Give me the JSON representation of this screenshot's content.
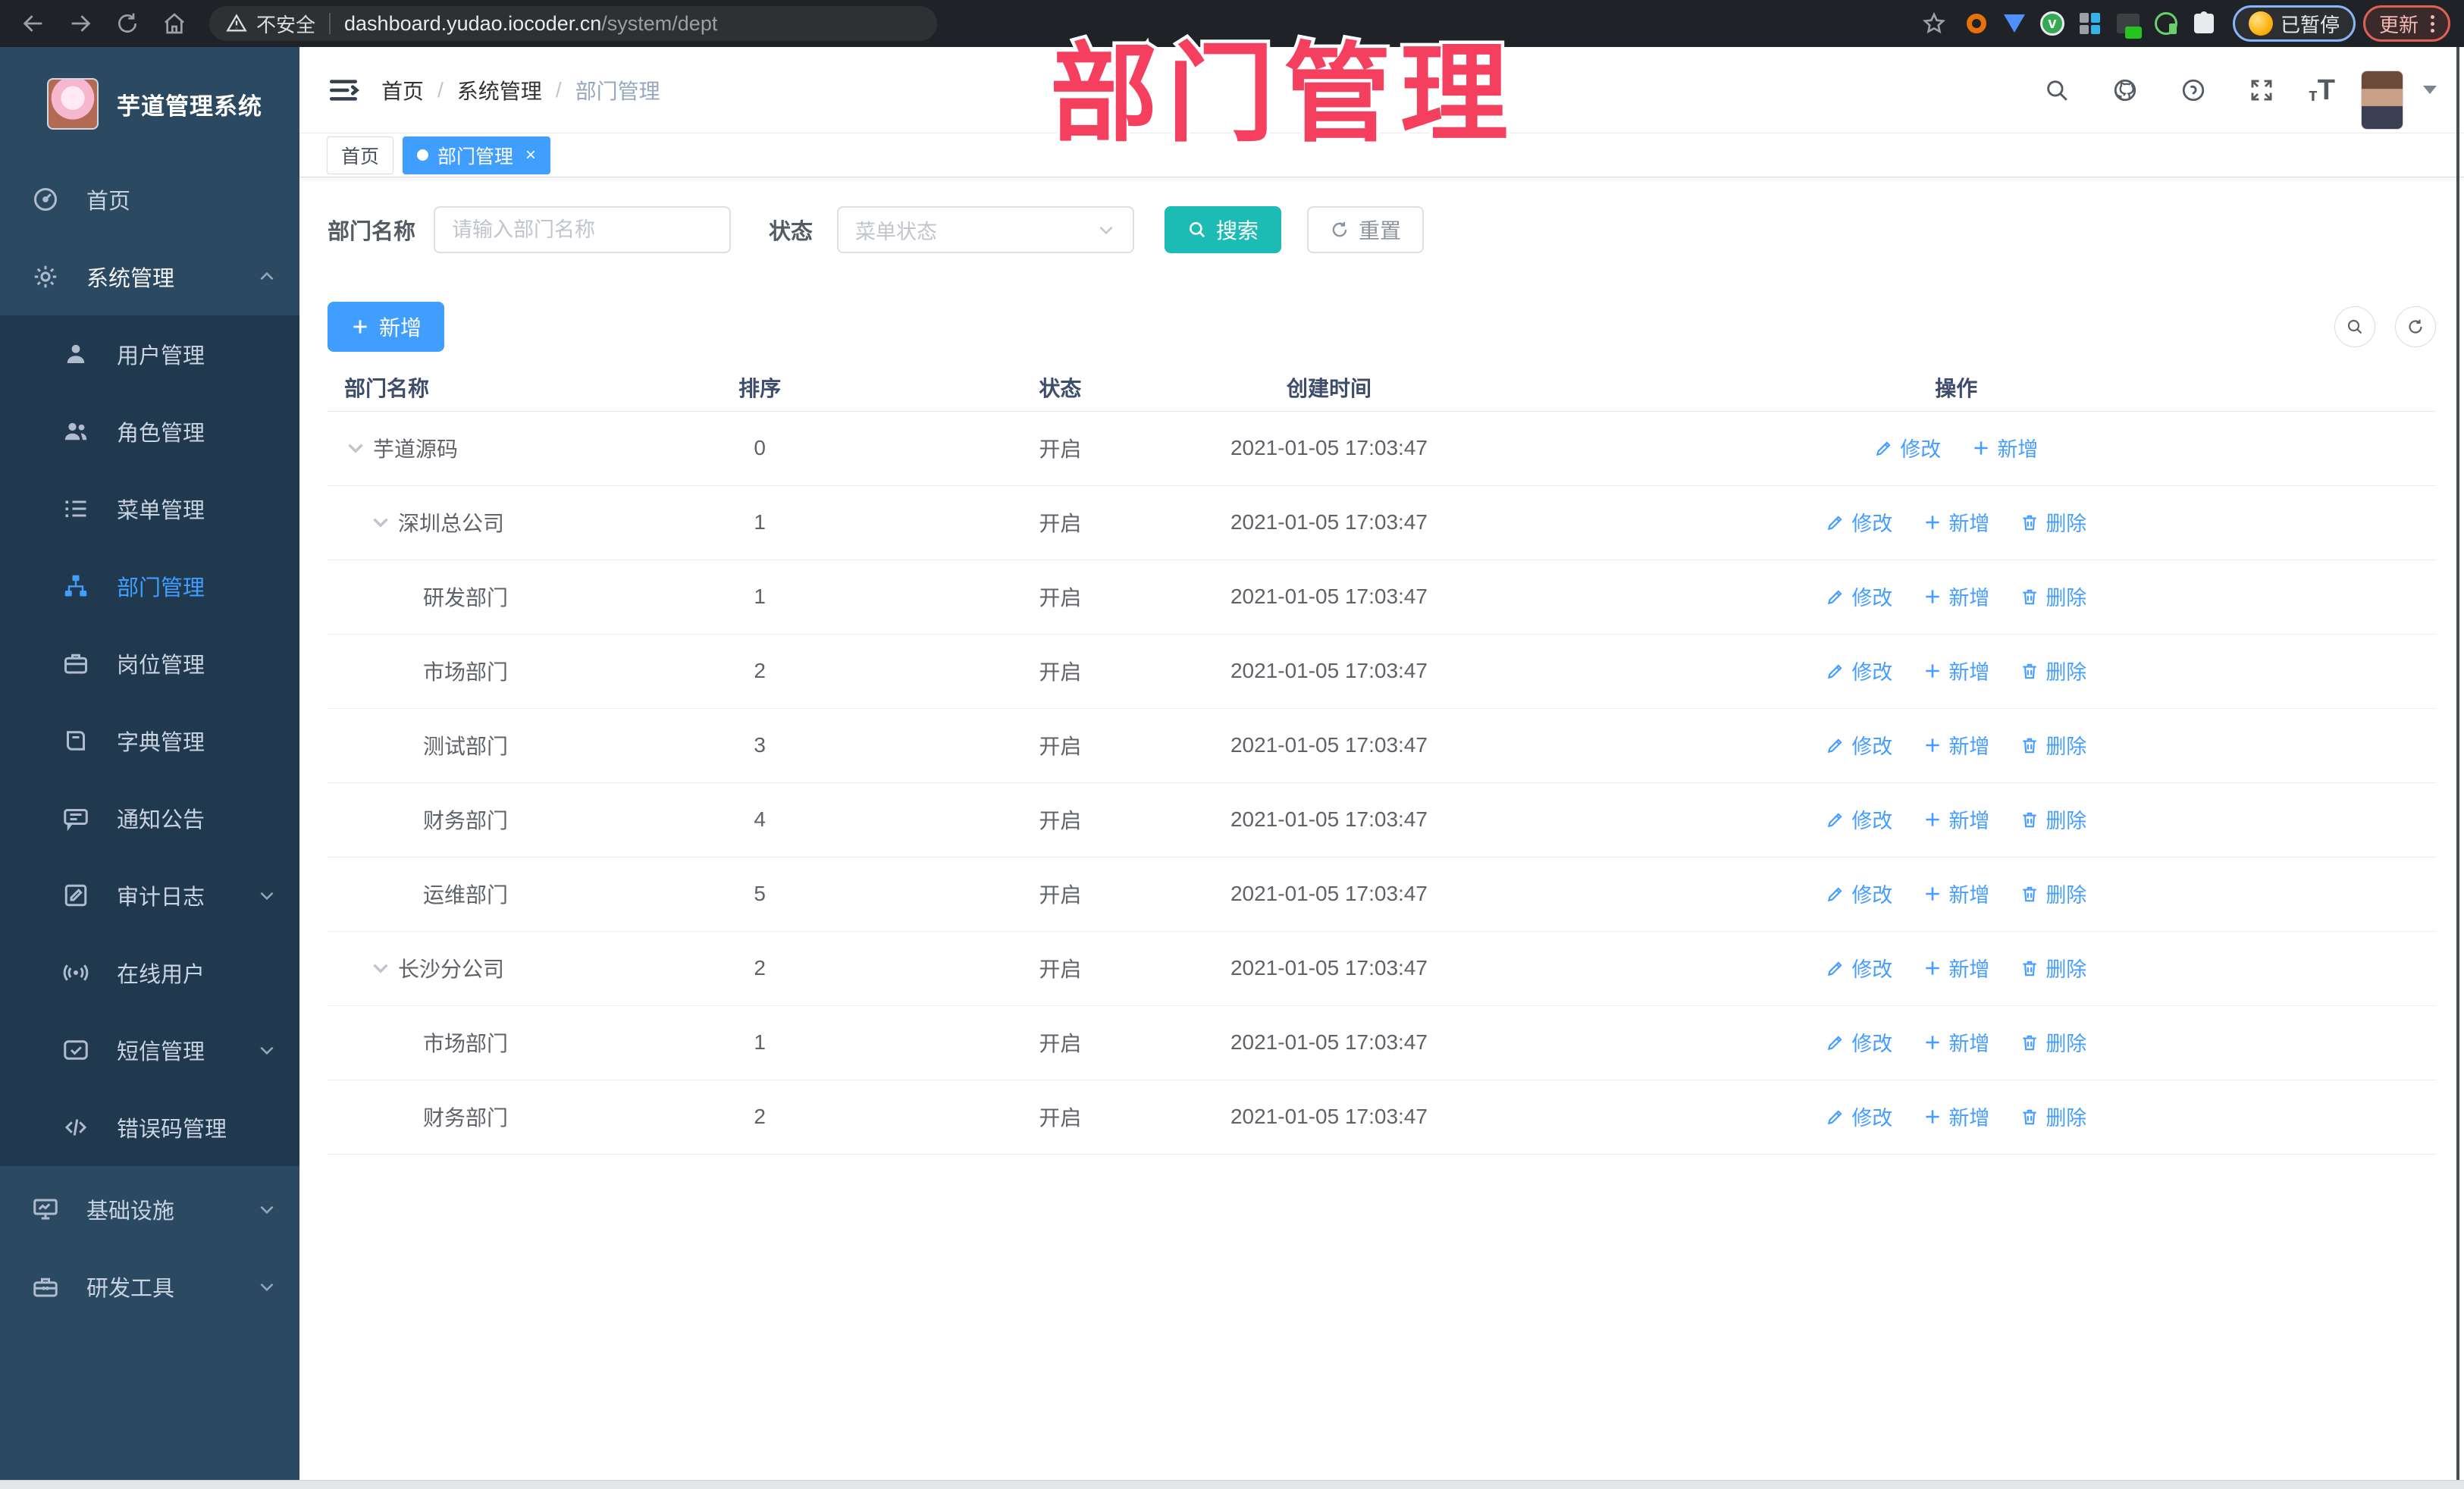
{
  "browser": {
    "security_text": "不安全",
    "url_host": "dashboard.yudao.iocoder.cn",
    "url_path": "/system/dept",
    "profile_status": "已暂停",
    "update_label": "更新"
  },
  "overlay": {
    "title": "部门管理"
  },
  "sidebar": {
    "logo_title": "芋道管理系统",
    "home": "首页",
    "system": "系统管理",
    "children": [
      "用户管理",
      "角色管理",
      "菜单管理",
      "部门管理",
      "岗位管理",
      "字典管理",
      "通知公告",
      "审计日志",
      "在线用户",
      "短信管理",
      "错误码管理"
    ],
    "infra": "基础设施",
    "devtools": "研发工具"
  },
  "header": {
    "breadcrumb": [
      "首页",
      "系统管理",
      "部门管理"
    ]
  },
  "tabs": {
    "home": "首页",
    "active": "部门管理"
  },
  "filters": {
    "dept_label": "部门名称",
    "dept_placeholder": "请输入部门名称",
    "status_label": "状态",
    "status_placeholder": "菜单状态",
    "search_label": "搜索",
    "reset_label": "重置"
  },
  "toolbar": {
    "add_label": "新增"
  },
  "table": {
    "columns": [
      "部门名称",
      "排序",
      "状态",
      "创建时间",
      "操作"
    ],
    "op_labels": {
      "edit": "修改",
      "add": "新增",
      "delete": "删除"
    },
    "rows": [
      {
        "name": "芋道源码",
        "level": 0,
        "expand": true,
        "sort": "0",
        "status": "开启",
        "created": "2021-01-05 17:03:47",
        "ops": [
          "edit",
          "add"
        ]
      },
      {
        "name": "深圳总公司",
        "level": 1,
        "expand": true,
        "sort": "1",
        "status": "开启",
        "created": "2021-01-05 17:03:47",
        "ops": [
          "edit",
          "add",
          "delete"
        ]
      },
      {
        "name": "研发部门",
        "level": 2,
        "expand": false,
        "sort": "1",
        "status": "开启",
        "created": "2021-01-05 17:03:47",
        "ops": [
          "edit",
          "add",
          "delete"
        ]
      },
      {
        "name": "市场部门",
        "level": 2,
        "expand": false,
        "sort": "2",
        "status": "开启",
        "created": "2021-01-05 17:03:47",
        "ops": [
          "edit",
          "add",
          "delete"
        ]
      },
      {
        "name": "测试部门",
        "level": 2,
        "expand": false,
        "sort": "3",
        "status": "开启",
        "created": "2021-01-05 17:03:47",
        "ops": [
          "edit",
          "add",
          "delete"
        ]
      },
      {
        "name": "财务部门",
        "level": 2,
        "expand": false,
        "sort": "4",
        "status": "开启",
        "created": "2021-01-05 17:03:47",
        "ops": [
          "edit",
          "add",
          "delete"
        ]
      },
      {
        "name": "运维部门",
        "level": 2,
        "expand": false,
        "sort": "5",
        "status": "开启",
        "created": "2021-01-05 17:03:47",
        "ops": [
          "edit",
          "add",
          "delete"
        ]
      },
      {
        "name": "长沙分公司",
        "level": 1,
        "expand": true,
        "sort": "2",
        "status": "开启",
        "created": "2021-01-05 17:03:47",
        "ops": [
          "edit",
          "add",
          "delete"
        ]
      },
      {
        "name": "市场部门",
        "level": 2,
        "expand": false,
        "sort": "1",
        "status": "开启",
        "created": "2021-01-05 17:03:47",
        "ops": [
          "edit",
          "add",
          "delete"
        ]
      },
      {
        "name": "财务部门",
        "level": 2,
        "expand": false,
        "sort": "2",
        "status": "开启",
        "created": "2021-01-05 17:03:47",
        "ops": [
          "edit",
          "add",
          "delete"
        ]
      }
    ]
  },
  "colors": {
    "accent": "#409eff",
    "teal": "#1cbbb4",
    "annotation_pink": "#f43f5e",
    "sidebar_bg": "#2b4961",
    "submenu_bg": "#20394e"
  }
}
